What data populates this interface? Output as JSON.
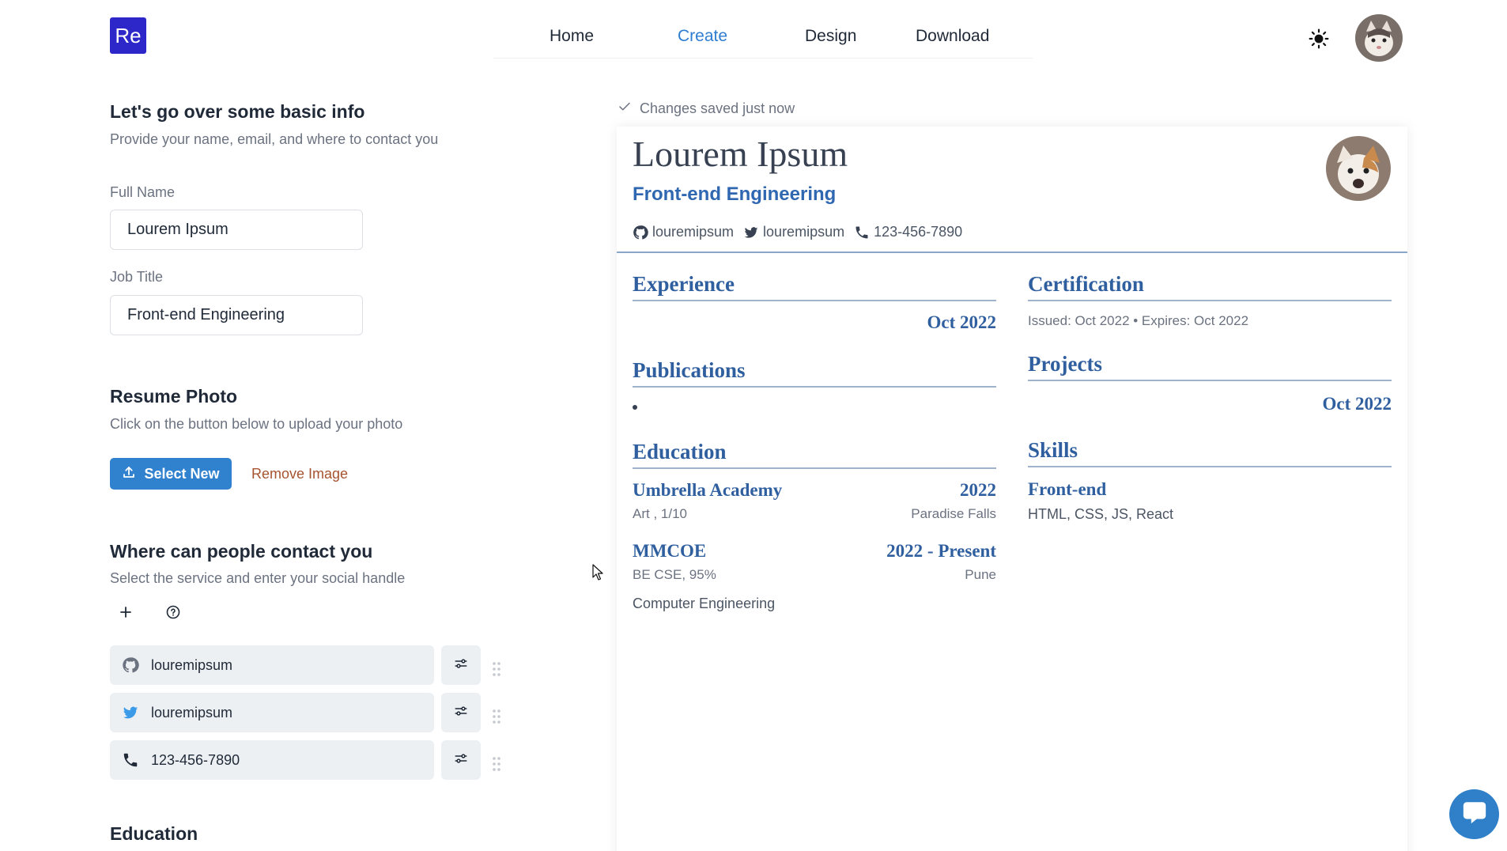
{
  "header": {
    "logo": "Re",
    "nav": [
      "Home",
      "Create",
      "Design",
      "Download"
    ],
    "active_nav": "Create"
  },
  "basic_info": {
    "title": "Let's go over some basic info",
    "subtitle": "Provide your name, email, and where to contact you",
    "full_name_label": "Full Name",
    "full_name_value": "Lourem Ipsum",
    "job_title_label": "Job Title",
    "job_title_value": "Front-end Engineering"
  },
  "photo": {
    "title": "Resume Photo",
    "subtitle": "Click on the button below to upload your photo",
    "select_label": "Select New",
    "remove_label": "Remove Image"
  },
  "contact": {
    "title": "Where can people contact you",
    "subtitle": "Select the service and enter your social handle",
    "items": [
      {
        "icon": "github-icon",
        "value": "louremipsum"
      },
      {
        "icon": "twitter-icon",
        "value": "louremipsum"
      },
      {
        "icon": "phone-icon",
        "value": "123-456-7890"
      }
    ]
  },
  "education_form": {
    "title": "Education"
  },
  "preview": {
    "saved_status": "Changes saved just now",
    "name": "Lourem Ipsum",
    "job_title": "Front-end Engineering",
    "contacts": [
      {
        "icon": "github-icon",
        "value": "louremipsum"
      },
      {
        "icon": "twitter-icon",
        "value": "louremipsum"
      },
      {
        "icon": "phone-icon",
        "value": "123-456-7890"
      }
    ],
    "experience": {
      "title": "Experience",
      "date": "Oct 2022"
    },
    "publications": {
      "title": "Publications"
    },
    "education": {
      "title": "Education",
      "entries": [
        {
          "org": "Umbrella Academy",
          "date": "2022",
          "detail": "Art , 1/10",
          "location": "Paradise Falls"
        },
        {
          "org": "MMCOE",
          "date": "2022 - Present",
          "detail": "BE CSE, 95%",
          "location": "Pune",
          "note": "Computer Engineering"
        }
      ]
    },
    "certification": {
      "title": "Certification",
      "meta": "Issued: Oct 2022 • Expires: Oct 2022"
    },
    "projects": {
      "title": "Projects",
      "date": "Oct 2022"
    },
    "skills": {
      "title": "Skills",
      "group": "Front-end",
      "items": "HTML, CSS, JS, React"
    }
  },
  "colors": {
    "brand": "#2d27c9",
    "accent": "#3182ce",
    "resume_heading": "#2f5f9f",
    "remove_link": "#a6532f"
  }
}
